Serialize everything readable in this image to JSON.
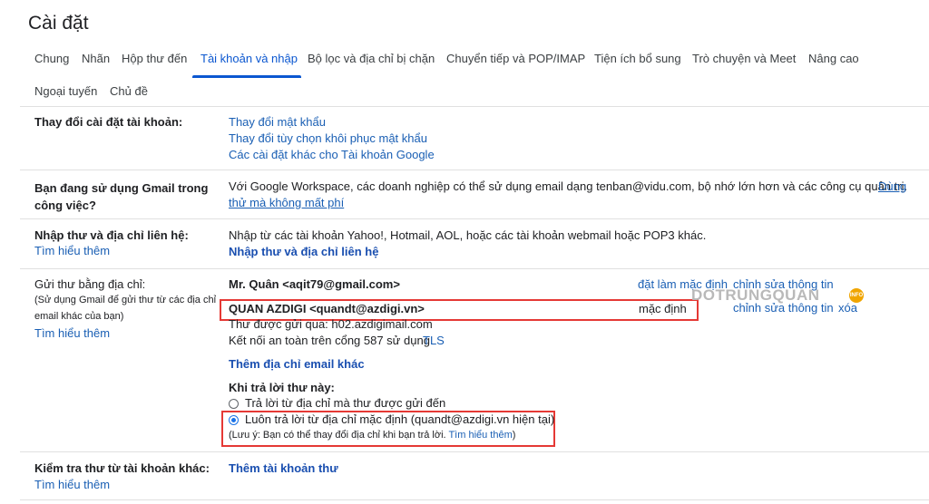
{
  "page_title": "Cài đặt",
  "tabs": [
    "Chung",
    "Nhãn",
    "Hộp thư đến",
    "Tài khoản và nhập",
    "Bộ lọc và địa chỉ bị chặn",
    "Chuyển tiếp và POP/IMAP",
    "Tiện ích bổ sung",
    "Trò chuyện và Meet",
    "Nâng cao",
    "Ngoại tuyến",
    "Chủ đề"
  ],
  "active_tab": "Tài khoản và nhập",
  "change_account": {
    "label": "Thay đổi cài đặt tài khoản:",
    "links": [
      "Thay đổi mật khẩu",
      "Thay đổi tùy chọn khôi phục mật khẩu",
      "Các cài đặt khác cho Tài khoản Google"
    ]
  },
  "workspace": {
    "label": "Bạn đang sử dụng Gmail trong công việc?",
    "text": "Với Google Workspace, các doanh nghiệp có thể sử dụng email dạng tenban@vidu.com, bộ nhớ lớn hơn và các công cụ quản trị.",
    "link_start": "Dùng",
    "link_end": "thử mà không mất phí"
  },
  "import": {
    "label": "Nhập thư và địa chỉ liên hệ:",
    "learn_more": "Tìm hiểu thêm",
    "text": "Nhập từ các tài khoản Yahoo!, Hotmail, AOL, hoặc các tài khoản webmail hoặc POP3 khác.",
    "action": "Nhập thư và địa chỉ liên hệ"
  },
  "send_as": {
    "label": "Gửi thư bằng địa chỉ:",
    "note_line1": "(Sử dụng Gmail để gửi thư từ các địa chỉ",
    "note_line2": "email khác của bạn)",
    "learn_more": "Tìm hiểu thêm",
    "addresses": [
      {
        "address": "Mr. Quân <aqit79@gmail.com>",
        "actions": [
          "đặt làm mặc định",
          "chỉnh sửa thông tin"
        ]
      },
      {
        "address": "QUAN AZDIGI <quandt@azdigi.vn>",
        "status": "mặc định",
        "actions": [
          "chỉnh sửa thông tin",
          "xóa"
        ]
      }
    ],
    "sent_via": "Thư được gửi qua: h02.azdigimail.com",
    "secure_prefix": "Kết nối an toàn trên cổng 587 sử dụng",
    "secure_link": "TLS",
    "add_other": "Thêm địa chỉ email khác",
    "reply_heading": "Khi trả lời thư này:",
    "reply_options": [
      {
        "label": "Trả lời từ địa chỉ mà thư được gửi đến",
        "selected": false
      },
      {
        "label": "Luôn trả lời từ địa chỉ mặc định (quandt@azdigi.vn hiện tại)",
        "selected": true
      }
    ],
    "reply_note": "(Lưu ý: Bạn có thể thay đổi địa chỉ khi bạn trả lời.",
    "reply_note_link": "Tìm hiểu thêm",
    "reply_note_end": ")"
  },
  "check_mail": {
    "label": "Kiểm tra thư từ tài khoản khác:",
    "learn_more": "Tìm hiểu thêm",
    "action": "Thêm tài khoản thư"
  },
  "watermark": {
    "text": "DOTRUNGQUAN",
    "badge": "INFO"
  },
  "colors": {
    "accent": "#0b57d0",
    "link": "#1a5fb4",
    "highlight_box": "#e53935"
  }
}
